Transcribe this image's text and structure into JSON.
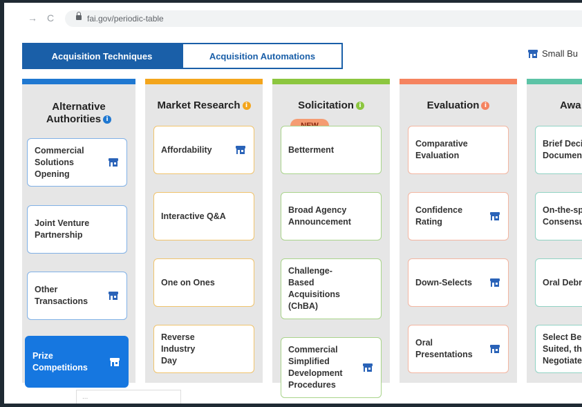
{
  "browser": {
    "url": "fai.gov/periodic-table",
    "back_icon": "back-arrow-icon",
    "reload_icon": "reload-icon"
  },
  "tabs": [
    {
      "label": "Acquisition Techniques",
      "active": true
    },
    {
      "label": "Acquisition Automations",
      "active": false
    }
  ],
  "small_business": {
    "label": "Small Bu",
    "icon": "storefront-icon"
  },
  "colors": {
    "accent": "#1a5fa8",
    "selected": "#1677e0",
    "alt": "#1f78d1",
    "market": "#f3a51c",
    "solicitation": "#8cc63f",
    "evaluation": "#f5835f",
    "award": "#5cc3a6"
  },
  "columns": [
    {
      "title_line1": "Alternative",
      "title_line2": "Authorities",
      "items": [
        {
          "label": "Commercial Solutions Opening",
          "small_business": true
        },
        {
          "label": "Joint Venture Partnership",
          "small_business": false
        },
        {
          "label": "Other Transactions",
          "small_business": true
        },
        {
          "label": "Prize Competitions",
          "small_business": true,
          "selected": true
        }
      ]
    },
    {
      "title": "Market Research",
      "items": [
        {
          "label": "Affordability",
          "small_business": true
        },
        {
          "label": "Interactive Q&A",
          "small_business": false
        },
        {
          "label": "One on Ones",
          "small_business": false
        },
        {
          "label": "Reverse Industry Day",
          "small_business": false
        }
      ]
    },
    {
      "title": "Solicitation",
      "new_badge": "NEW",
      "items": [
        {
          "label": "Betterment",
          "small_business": false
        },
        {
          "label": "Broad Agency Announcement",
          "small_business": false
        },
        {
          "label": "Challenge-Based Acquisitions (ChBA)",
          "small_business": false
        },
        {
          "label": "Commercial Simplified Development Procedures",
          "small_business": true
        }
      ]
    },
    {
      "title": "Evaluation",
      "items": [
        {
          "label": "Comparative Evaluation",
          "small_business": false
        },
        {
          "label": "Confidence Rating",
          "small_business": true
        },
        {
          "label": "Down-Selects",
          "small_business": true
        },
        {
          "label": "Oral Presentations",
          "small_business": true
        }
      ]
    },
    {
      "title": "Awa",
      "items": [
        {
          "label": "Brief Deci Documen",
          "small_business": false
        },
        {
          "label": "On-the-sp Consensu",
          "small_business": false
        },
        {
          "label": "Oral Debr",
          "small_business": false
        },
        {
          "label": "Select Be Suited, th Negotiate",
          "small_business": false
        }
      ]
    }
  ],
  "tooltip_text": "..."
}
